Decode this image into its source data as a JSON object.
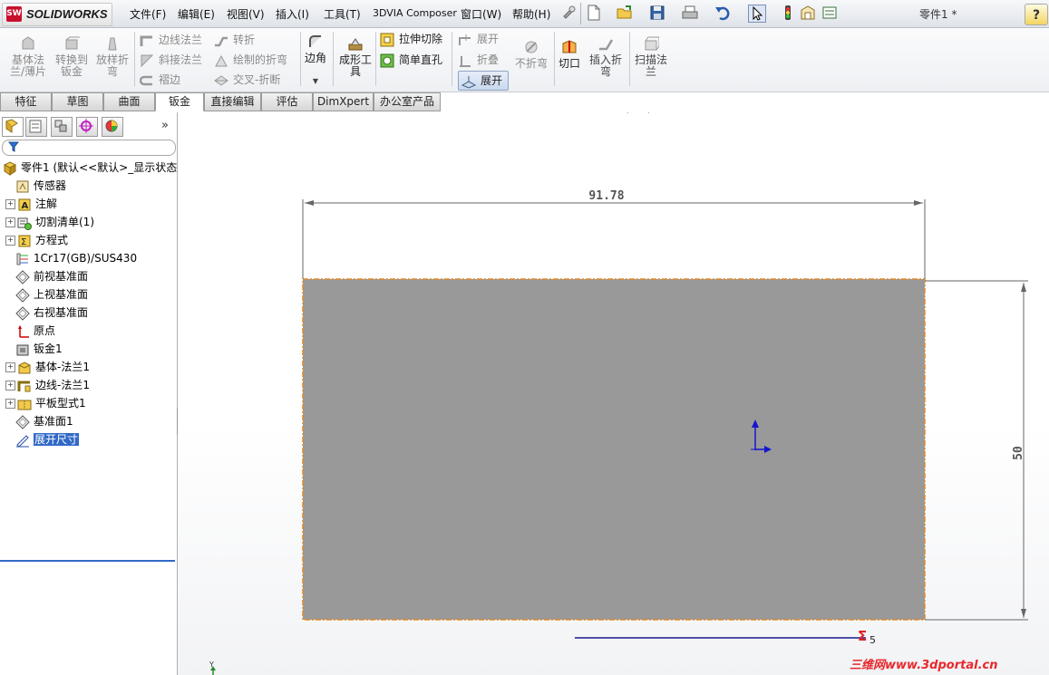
{
  "app": {
    "logo_badge": "SW",
    "logo_text": "SOLIDWORKS",
    "document_title": "零件1 *"
  },
  "menu": [
    "文件(F)",
    "编辑(E)",
    "视图(V)",
    "插入(I)",
    "工具(T)",
    "3DVIA Composer",
    "窗口(W)",
    "帮助(H)"
  ],
  "ribbon": {
    "base_flange": "基体法\n兰/薄片",
    "convert_to_sheet": "转换到\n钣金",
    "lofted_bend": "放样折\n弯",
    "edge_flange": "边线法兰",
    "miter_flange": "斜接法兰",
    "hem": "褶边",
    "jog": "转折",
    "sketched_bend": "绘制的折弯",
    "cross_break": "交叉-折断",
    "corners": "边角",
    "forming_tool": "成形工\n具",
    "extruded_cut": "拉伸切除",
    "simple_hole": "简单直孔",
    "unfold": "展开",
    "fold": "折叠",
    "flatten": "展开",
    "no_bends": "不折弯",
    "rip": "切口",
    "insert_bends": "插入折\n弯",
    "swept_flange": "扫描法\n兰"
  },
  "tabs": [
    "特征",
    "草图",
    "曲面",
    "钣金",
    "直接编辑",
    "评估",
    "DimXpert",
    "办公室产品"
  ],
  "active_tab": "钣金",
  "feature_tree": {
    "root": "零件1 (默认<<默认>_显示状态",
    "items": [
      {
        "label": "传感器",
        "expandable": false,
        "icon": "sensor-icon"
      },
      {
        "label": "注解",
        "expandable": true,
        "icon": "annotation-icon"
      },
      {
        "label": "切割清单(1)",
        "expandable": true,
        "icon": "cut-list-icon"
      },
      {
        "label": "方程式",
        "expandable": true,
        "icon": "equation-icon"
      },
      {
        "label": "1Cr17(GB)/SUS430",
        "expandable": false,
        "icon": "material-icon"
      },
      {
        "label": "前视基准面",
        "expandable": false,
        "icon": "plane-icon"
      },
      {
        "label": "上视基准面",
        "expandable": false,
        "icon": "plane-icon"
      },
      {
        "label": "右视基准面",
        "expandable": false,
        "icon": "plane-icon"
      },
      {
        "label": "原点",
        "expandable": false,
        "icon": "origin-icon"
      },
      {
        "label": "钣金1",
        "expandable": false,
        "icon": "sheet-metal-icon"
      },
      {
        "label": "基体-法兰1",
        "expandable": true,
        "icon": "base-flange-icon"
      },
      {
        "label": "边线-法兰1",
        "expandable": true,
        "icon": "edge-flange-icon"
      },
      {
        "label": "平板型式1",
        "expandable": true,
        "icon": "flat-pattern-icon"
      },
      {
        "label": "基准面1",
        "expandable": false,
        "icon": "plane-icon"
      },
      {
        "label": "展开尺寸",
        "expandable": false,
        "icon": "sketch-icon",
        "selected": true
      }
    ]
  },
  "drawing": {
    "width_dim": "91.78",
    "height_dim": "50",
    "sigma_label": "Σ",
    "sigma_value": "5",
    "triad_label": "Y",
    "fill_color": "#999999",
    "edge_color": "#e08a2a"
  },
  "watermark": "三维网www.3dportal.cn"
}
